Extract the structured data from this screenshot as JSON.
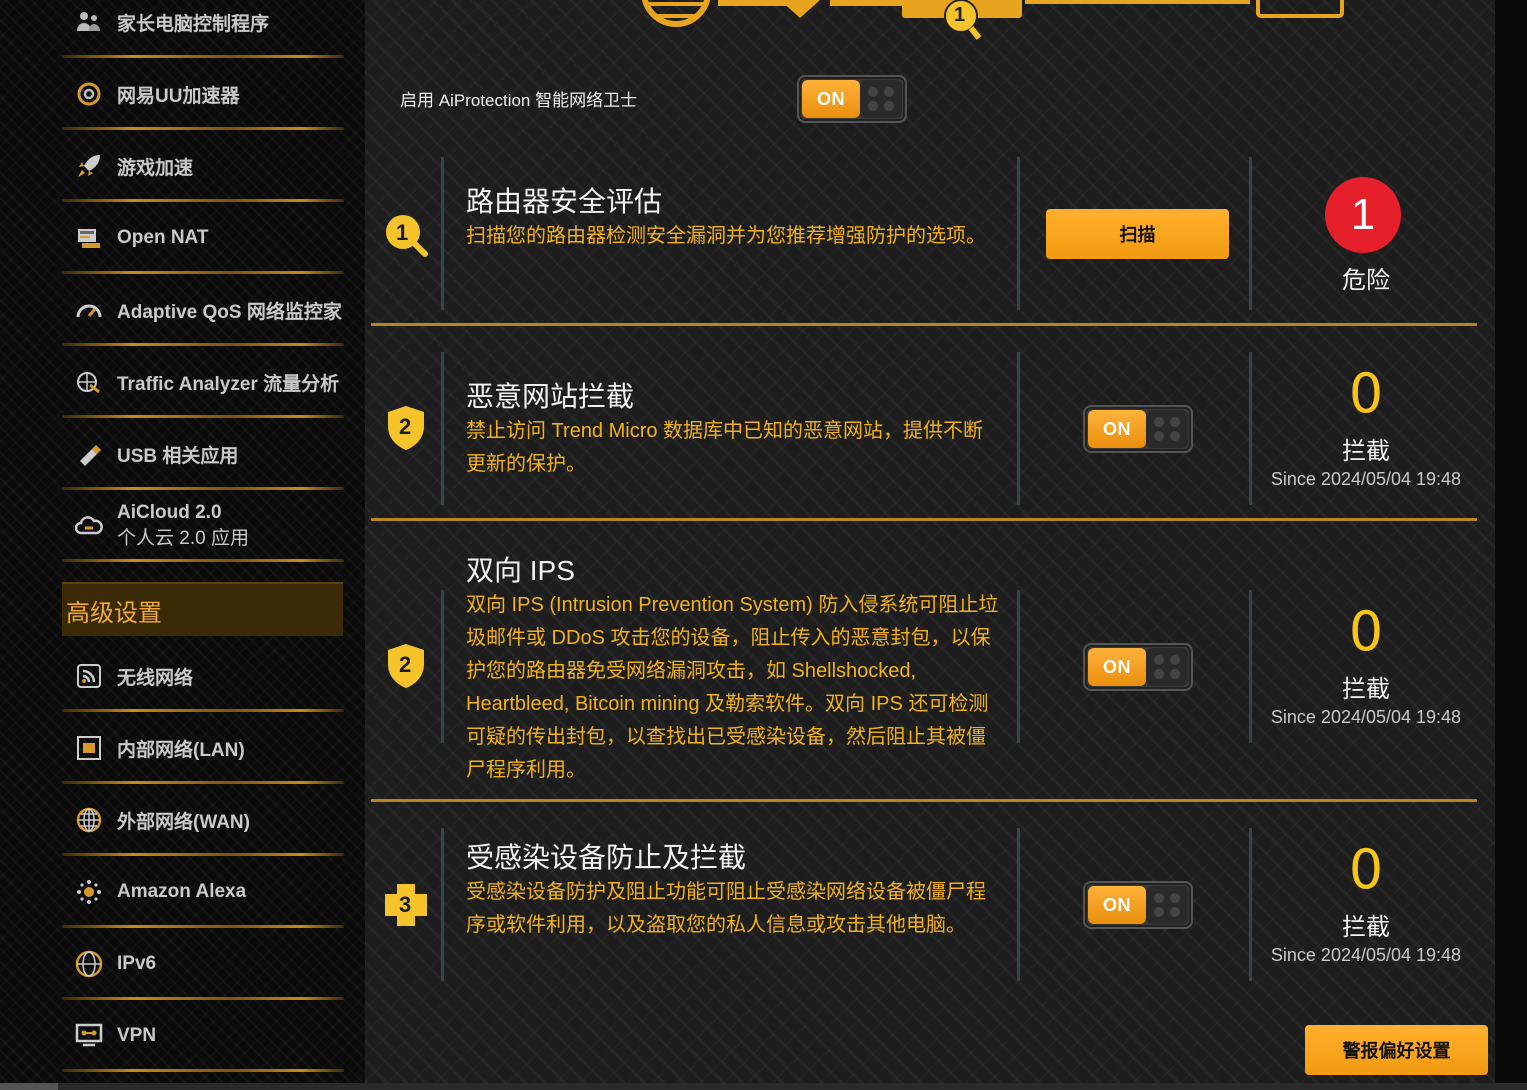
{
  "sidebar": {
    "items": [
      {
        "label": "家长电脑控制程序",
        "icon": "parental-control-icon"
      },
      {
        "label": "网易UU加速器",
        "icon": "uu-accelerator-icon"
      },
      {
        "label": "游戏加速",
        "icon": "rocket-icon"
      },
      {
        "label": "Open NAT",
        "icon": "open-nat-icon"
      },
      {
        "label": "Adaptive QoS 网络监控家",
        "icon": "speedometer-icon"
      },
      {
        "label": "Traffic Analyzer 流量分析",
        "icon": "traffic-analyzer-icon"
      },
      {
        "label": "USB 相关应用",
        "icon": "usb-icon"
      },
      {
        "label": "AiCloud 2.0",
        "label2": "个人云 2.0 应用",
        "icon": "cloud-icon"
      }
    ],
    "advanced_header": "高级设置",
    "advanced_items": [
      {
        "label": "无线网络",
        "icon": "wireless-icon"
      },
      {
        "label": "内部网络(LAN)",
        "icon": "lan-icon"
      },
      {
        "label": "外部网络(WAN)",
        "icon": "wan-globe-icon"
      },
      {
        "label": "Amazon Alexa",
        "icon": "alexa-icon"
      },
      {
        "label": "IPv6",
        "icon": "ipv6-icon"
      },
      {
        "label": "VPN",
        "icon": "vpn-icon"
      }
    ]
  },
  "main": {
    "enable_label": "启用 AiProtection 智能网络卫士",
    "toggle_on_text": "ON",
    "sections": [
      {
        "badge": "1",
        "title": "路由器安全评估",
        "description": "扫描您的路由器检测安全漏洞并为您推荐增强防护的选项。",
        "button": "扫描",
        "count": "1",
        "status": "危险"
      },
      {
        "badge": "2",
        "title": "恶意网站拦截",
        "description": "禁止访问 Trend Micro 数据库中已知的恶意网站，提供不断更新的保护。",
        "count": "0",
        "status": "拦截",
        "since": "Since 2024/05/04 19:48"
      },
      {
        "badge": "2",
        "title": "双向 IPS",
        "description": "双向 IPS (Intrusion Prevention System) 防入侵系统可阻止垃圾邮件或 DDoS 攻击您的设备，阻止传入的恶意封包，以保护您的路由器免受网络漏洞攻击，如 Shellshocked, Heartbleed, Bitcoin mining 及勒索软件。双向 IPS 还可检测可疑的传出封包，以查找出已受感染设备，然后阻止其被僵尸程序利用。",
        "count": "0",
        "status": "拦截",
        "since": "Since 2024/05/04 19:48"
      },
      {
        "badge": "3",
        "title": "受感染设备防止及拦截",
        "description": "受感染设备防护及阻止功能可阻止受感染网络设备被僵尸程序或软件利用，以及盗取您的私人信息或攻击其他电脑。",
        "count": "0",
        "status": "拦截",
        "since": "Since 2024/05/04 19:48"
      }
    ],
    "alert_pref_button": "警报偏好设置",
    "diagram_badge": "1"
  },
  "colors": {
    "accent": "#f29a10",
    "desc_text": "#f2b21e",
    "danger": "#e5202a",
    "separator": "#b8861c"
  }
}
